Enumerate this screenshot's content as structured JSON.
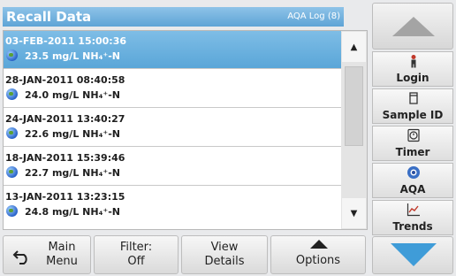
{
  "header": {
    "title": "Recall Data",
    "log_label": "AQA Log (8)"
  },
  "records": [
    {
      "date": "03-FEB-2011  15:00:36",
      "value": "23.5  mg/L  NH₄⁺-N"
    },
    {
      "date": "28-JAN-2011  08:40:58",
      "value": "24.0  mg/L  NH₄⁺-N"
    },
    {
      "date": "24-JAN-2011  13:40:27",
      "value": "22.6  mg/L  NH₄⁺-N"
    },
    {
      "date": "18-JAN-2011  15:39:46",
      "value": "22.7  mg/L  NH₄⁺-N"
    },
    {
      "date": "13-JAN-2011  13:23:15",
      "value": "24.8  mg/L  NH₄⁺-N"
    }
  ],
  "bottom_buttons": {
    "main_menu": [
      "Main",
      "Menu"
    ],
    "filter": [
      "Filter:",
      "Off"
    ],
    "view_details": [
      "View",
      "Details"
    ],
    "options": "Options"
  },
  "side_menu": {
    "login": "Login",
    "sample_id": "Sample ID",
    "timer": "Timer",
    "aqa": "AQA",
    "trends": "Trends"
  },
  "colors": {
    "header": "#6aaedd",
    "selection": "#6ab3e2",
    "down_arrow": "#3f9cd8"
  }
}
